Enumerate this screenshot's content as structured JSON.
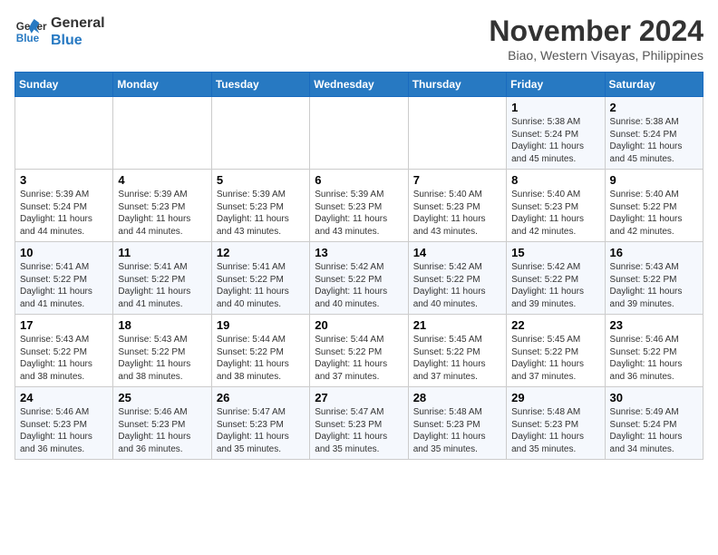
{
  "logo": {
    "line1": "General",
    "line2": "Blue"
  },
  "title": {
    "month_year": "November 2024",
    "location": "Biao, Western Visayas, Philippines"
  },
  "headers": [
    "Sunday",
    "Monday",
    "Tuesday",
    "Wednesday",
    "Thursday",
    "Friday",
    "Saturday"
  ],
  "weeks": [
    [
      {
        "day": "",
        "info": ""
      },
      {
        "day": "",
        "info": ""
      },
      {
        "day": "",
        "info": ""
      },
      {
        "day": "",
        "info": ""
      },
      {
        "day": "",
        "info": ""
      },
      {
        "day": "1",
        "info": "Sunrise: 5:38 AM\nSunset: 5:24 PM\nDaylight: 11 hours\nand 45 minutes."
      },
      {
        "day": "2",
        "info": "Sunrise: 5:38 AM\nSunset: 5:24 PM\nDaylight: 11 hours\nand 45 minutes."
      }
    ],
    [
      {
        "day": "3",
        "info": "Sunrise: 5:39 AM\nSunset: 5:24 PM\nDaylight: 11 hours\nand 44 minutes."
      },
      {
        "day": "4",
        "info": "Sunrise: 5:39 AM\nSunset: 5:23 PM\nDaylight: 11 hours\nand 44 minutes."
      },
      {
        "day": "5",
        "info": "Sunrise: 5:39 AM\nSunset: 5:23 PM\nDaylight: 11 hours\nand 43 minutes."
      },
      {
        "day": "6",
        "info": "Sunrise: 5:39 AM\nSunset: 5:23 PM\nDaylight: 11 hours\nand 43 minutes."
      },
      {
        "day": "7",
        "info": "Sunrise: 5:40 AM\nSunset: 5:23 PM\nDaylight: 11 hours\nand 43 minutes."
      },
      {
        "day": "8",
        "info": "Sunrise: 5:40 AM\nSunset: 5:23 PM\nDaylight: 11 hours\nand 42 minutes."
      },
      {
        "day": "9",
        "info": "Sunrise: 5:40 AM\nSunset: 5:22 PM\nDaylight: 11 hours\nand 42 minutes."
      }
    ],
    [
      {
        "day": "10",
        "info": "Sunrise: 5:41 AM\nSunset: 5:22 PM\nDaylight: 11 hours\nand 41 minutes."
      },
      {
        "day": "11",
        "info": "Sunrise: 5:41 AM\nSunset: 5:22 PM\nDaylight: 11 hours\nand 41 minutes."
      },
      {
        "day": "12",
        "info": "Sunrise: 5:41 AM\nSunset: 5:22 PM\nDaylight: 11 hours\nand 40 minutes."
      },
      {
        "day": "13",
        "info": "Sunrise: 5:42 AM\nSunset: 5:22 PM\nDaylight: 11 hours\nand 40 minutes."
      },
      {
        "day": "14",
        "info": "Sunrise: 5:42 AM\nSunset: 5:22 PM\nDaylight: 11 hours\nand 40 minutes."
      },
      {
        "day": "15",
        "info": "Sunrise: 5:42 AM\nSunset: 5:22 PM\nDaylight: 11 hours\nand 39 minutes."
      },
      {
        "day": "16",
        "info": "Sunrise: 5:43 AM\nSunset: 5:22 PM\nDaylight: 11 hours\nand 39 minutes."
      }
    ],
    [
      {
        "day": "17",
        "info": "Sunrise: 5:43 AM\nSunset: 5:22 PM\nDaylight: 11 hours\nand 38 minutes."
      },
      {
        "day": "18",
        "info": "Sunrise: 5:43 AM\nSunset: 5:22 PM\nDaylight: 11 hours\nand 38 minutes."
      },
      {
        "day": "19",
        "info": "Sunrise: 5:44 AM\nSunset: 5:22 PM\nDaylight: 11 hours\nand 38 minutes."
      },
      {
        "day": "20",
        "info": "Sunrise: 5:44 AM\nSunset: 5:22 PM\nDaylight: 11 hours\nand 37 minutes."
      },
      {
        "day": "21",
        "info": "Sunrise: 5:45 AM\nSunset: 5:22 PM\nDaylight: 11 hours\nand 37 minutes."
      },
      {
        "day": "22",
        "info": "Sunrise: 5:45 AM\nSunset: 5:22 PM\nDaylight: 11 hours\nand 37 minutes."
      },
      {
        "day": "23",
        "info": "Sunrise: 5:46 AM\nSunset: 5:22 PM\nDaylight: 11 hours\nand 36 minutes."
      }
    ],
    [
      {
        "day": "24",
        "info": "Sunrise: 5:46 AM\nSunset: 5:23 PM\nDaylight: 11 hours\nand 36 minutes."
      },
      {
        "day": "25",
        "info": "Sunrise: 5:46 AM\nSunset: 5:23 PM\nDaylight: 11 hours\nand 36 minutes."
      },
      {
        "day": "26",
        "info": "Sunrise: 5:47 AM\nSunset: 5:23 PM\nDaylight: 11 hours\nand 35 minutes."
      },
      {
        "day": "27",
        "info": "Sunrise: 5:47 AM\nSunset: 5:23 PM\nDaylight: 11 hours\nand 35 minutes."
      },
      {
        "day": "28",
        "info": "Sunrise: 5:48 AM\nSunset: 5:23 PM\nDaylight: 11 hours\nand 35 minutes."
      },
      {
        "day": "29",
        "info": "Sunrise: 5:48 AM\nSunset: 5:23 PM\nDaylight: 11 hours\nand 35 minutes."
      },
      {
        "day": "30",
        "info": "Sunrise: 5:49 AM\nSunset: 5:24 PM\nDaylight: 11 hours\nand 34 minutes."
      }
    ]
  ]
}
